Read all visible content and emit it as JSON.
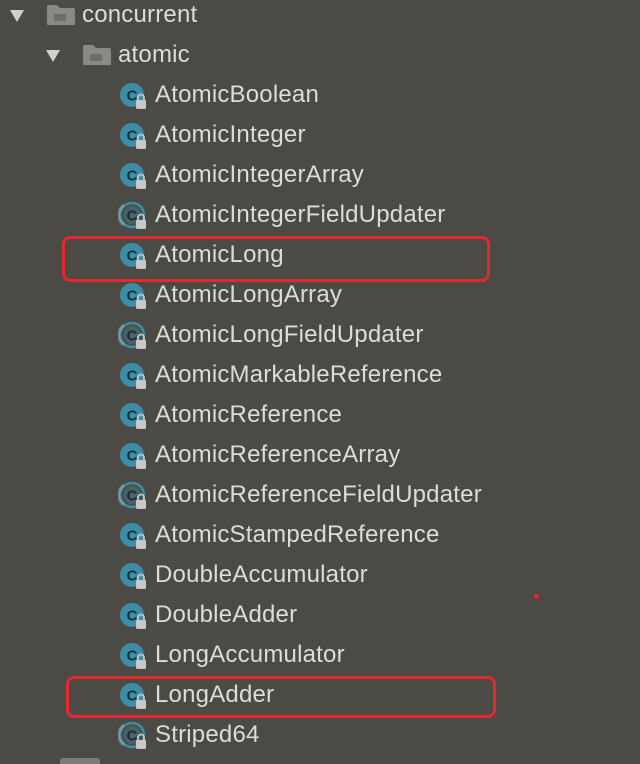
{
  "tree": {
    "package": "concurrent",
    "subpackage": "atomic",
    "classes": [
      {
        "name": "AtomicBoolean",
        "icon": "class-icon"
      },
      {
        "name": "AtomicInteger",
        "icon": "class-icon"
      },
      {
        "name": "AtomicIntegerArray",
        "icon": "class-icon"
      },
      {
        "name": "AtomicIntegerFieldUpdater",
        "icon": "abstract-class-icon"
      },
      {
        "name": "AtomicLong",
        "icon": "class-icon",
        "highlighted": true
      },
      {
        "name": "AtomicLongArray",
        "icon": "class-icon"
      },
      {
        "name": "AtomicLongFieldUpdater",
        "icon": "abstract-class-icon"
      },
      {
        "name": "AtomicMarkableReference",
        "icon": "class-icon"
      },
      {
        "name": "AtomicReference",
        "icon": "class-icon"
      },
      {
        "name": "AtomicReferenceArray",
        "icon": "class-icon"
      },
      {
        "name": "AtomicReferenceFieldUpdater",
        "icon": "abstract-class-icon"
      },
      {
        "name": "AtomicStampedReference",
        "icon": "class-icon"
      },
      {
        "name": "DoubleAccumulator",
        "icon": "class-icon"
      },
      {
        "name": "DoubleAdder",
        "icon": "class-icon"
      },
      {
        "name": "LongAccumulator",
        "icon": "class-icon"
      },
      {
        "name": "LongAdder",
        "icon": "class-icon",
        "highlighted": true
      },
      {
        "name": "Striped64",
        "icon": "abstract-class-icon"
      }
    ]
  },
  "colors": {
    "background": "#4b4a45",
    "text": "#dcdcdc",
    "class_icon": "#3b8ea6",
    "highlight": "#e5282e"
  }
}
